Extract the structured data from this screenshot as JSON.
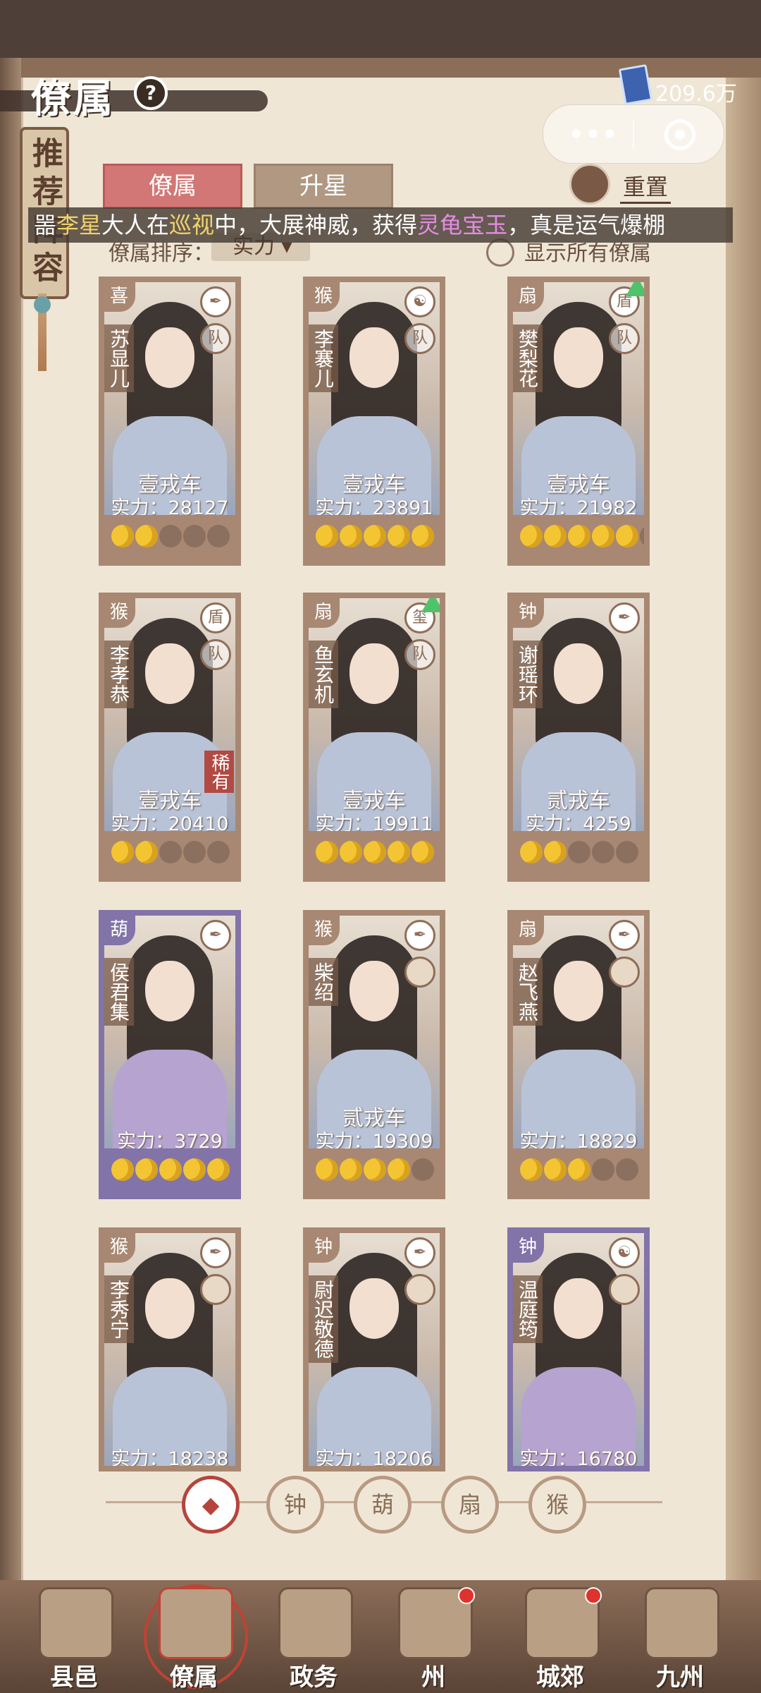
{
  "header": {
    "title": "僚属",
    "help": "?",
    "currency": "209.6万"
  },
  "banner": {
    "text": "推荐阵容"
  },
  "tabs": [
    {
      "label": "僚属",
      "active": true
    },
    {
      "label": "升星",
      "active": false
    }
  ],
  "reset_label": "重置",
  "marquee": {
    "prefix": "噐",
    "name": "李星",
    "mid1": "大人在",
    "action": "巡视",
    "mid2": "中，大展神威，获得",
    "item": "灵龟宝玉",
    "suffix": "，真是运气爆棚"
  },
  "sort": {
    "label": "僚属排序：",
    "selected": "实力",
    "show_all": "显示所有僚属"
  },
  "cards": [
    {
      "name": "苏显儿",
      "rank": "壹戎车",
      "power": "实力：28127",
      "stars": 2,
      "total": 5,
      "frame": "brown",
      "tl": "喜",
      "tr": "✒",
      "badge": "队"
    },
    {
      "name": "李褰儿",
      "rank": "壹戎车",
      "power": "实力：23891",
      "stars": 5,
      "total": 5,
      "frame": "brown",
      "tl": "猴",
      "tr": "☯",
      "badge": "队"
    },
    {
      "name": "樊梨花",
      "rank": "壹戎车",
      "power": "实力：21982",
      "stars": 5,
      "total": 6,
      "frame": "brown",
      "tl": "扇",
      "tr": "盾",
      "badge": "队",
      "up": true
    },
    {
      "name": "李孝恭",
      "rank": "壹戎车",
      "power": "实力：20410",
      "stars": 2,
      "total": 5,
      "frame": "brown",
      "tl": "猴",
      "tr": "盾",
      "badge": "队",
      "rare": "稀有"
    },
    {
      "name": "鱼玄机",
      "rank": "壹戎车",
      "power": "实力：19911",
      "stars": 5,
      "total": 5,
      "frame": "brown",
      "tl": "扇",
      "tr": "玺",
      "badge": "队",
      "up": true
    },
    {
      "name": "谢瑶环",
      "rank": "贰戎车",
      "power": "实力：4259",
      "stars": 2,
      "total": 5,
      "frame": "brown",
      "tl": "钟",
      "tr": "✒"
    },
    {
      "name": "侯君集",
      "rank": "",
      "power": "实力：3729",
      "stars": 5,
      "total": 5,
      "frame": "purple",
      "tl": "葫",
      "tr": "✒"
    },
    {
      "name": "柴绍",
      "rank": "贰戎车",
      "power": "实力：19309",
      "stars": 4,
      "total": 5,
      "frame": "brown",
      "tl": "猴",
      "tr": "✒",
      "avatar": true
    },
    {
      "name": "赵飞燕",
      "rank": "",
      "power": "实力：18829",
      "stars": 3,
      "total": 5,
      "frame": "brown",
      "tl": "扇",
      "tr": "✒",
      "avatar": true
    },
    {
      "name": "李秀宁",
      "rank": "",
      "power": "实力：18238",
      "stars": 0,
      "total": 0,
      "frame": "brown",
      "tl": "猴",
      "tr": "✒",
      "avatar": true
    },
    {
      "name": "尉迟敬德",
      "rank": "",
      "power": "实力：18206",
      "stars": 0,
      "total": 0,
      "frame": "brown",
      "tl": "钟",
      "tr": "✒",
      "avatar": true
    },
    {
      "name": "温庭筠",
      "rank": "",
      "power": "实力：16780",
      "stars": 0,
      "total": 0,
      "frame": "purple",
      "tl": "钟",
      "tr": "☯",
      "avatar": true
    }
  ],
  "filters": [
    {
      "icon": "◆",
      "name": "all",
      "selected": true
    },
    {
      "icon": "钟",
      "name": "bell",
      "selected": false
    },
    {
      "icon": "葫",
      "name": "gourd",
      "selected": false
    },
    {
      "icon": "扇",
      "name": "fan",
      "selected": false
    },
    {
      "icon": "猴",
      "name": "monkey",
      "selected": false
    }
  ],
  "nav": [
    {
      "label": "县邑",
      "dot": false,
      "selected": false
    },
    {
      "label": "僚属",
      "dot": false,
      "selected": true
    },
    {
      "label": "政务",
      "dot": false,
      "selected": false
    },
    {
      "label": "州",
      "dot": true,
      "selected": false
    },
    {
      "label": "城郊",
      "dot": true,
      "selected": false
    },
    {
      "label": "九州",
      "dot": false,
      "selected": false
    }
  ]
}
